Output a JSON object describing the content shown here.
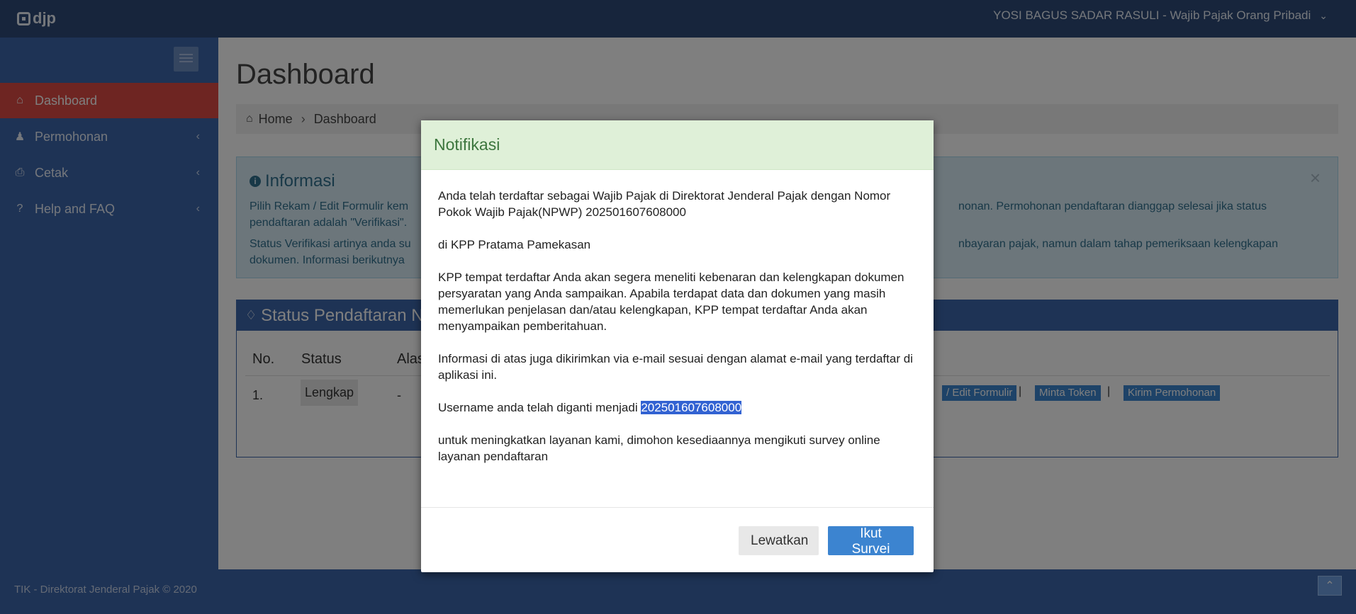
{
  "topbar": {
    "logo_text": "djp",
    "user_label": "YOSI BAGUS SADAR RASULI - Wajib Pajak Orang Pribadi"
  },
  "sidebar": {
    "items": [
      {
        "label": "Dashboard",
        "icon": "home-icon"
      },
      {
        "label": "Permohonan",
        "icon": "user-tie-icon"
      },
      {
        "label": "Cetak",
        "icon": "print-icon"
      },
      {
        "label": "Help and FAQ",
        "icon": "question-icon"
      }
    ]
  },
  "main": {
    "page_title": "Dashboard",
    "breadcrumb": {
      "home": "Home",
      "current": "Dashboard"
    },
    "info": {
      "title": "Informasi",
      "line1a": "Pilih Rekam / Edit Formulir kem",
      "line1b": "nonan. Permohonan pendaftaran dianggap selesai jika status",
      "line2a": "pendaftaran adalah \"Verifikasi\".",
      "line3a": "Status Verifikasi artinya anda su",
      "line3b": "nbayaran pajak, namun dalam tahap pemeriksaan kelengkapan",
      "line4a": "dokumen. Informasi berikutnya"
    },
    "status_panel": {
      "title": "Status Pendaftaran N",
      "columns": [
        "No.",
        "Status",
        "Alas"
      ],
      "row": {
        "no": "1.",
        "status": "Lengkap",
        "reason": "-"
      },
      "actions": [
        "/ Edit Formulir",
        "Minta Token",
        "Kirim Permohonan"
      ],
      "separator": "|"
    }
  },
  "footer": {
    "text": "TIK - Direktorat Jenderal Pajak © 2020"
  },
  "modal": {
    "title": "Notifikasi",
    "p1": "Anda telah terdaftar sebagai Wajib Pajak di Direktorat Jenderal Pajak dengan Nomor Pokok Wajib Pajak(NPWP) 202501607608000",
    "p2": "di KPP Pratama Pamekasan",
    "p3": "KPP tempat terdaftar Anda akan segera meneliti kebenaran dan kelengkapan dokumen persyaratan yang Anda sampaikan. Apabila terdapat data dan dokumen yang masih memerlukan penjelasan dan/atau kelengkapan, KPP tempat terdaftar Anda akan menyampaikan pemberitahuan.",
    "p4": "Informasi di atas juga dikirimkan via e-mail sesuai dengan alamat e-mail yang terdaftar di aplikasi ini.",
    "p5_prefix": "Username anda telah diganti menjadi ",
    "p5_username": "202501607608000",
    "p6": "untuk meningkatkan layanan kami, dimohon kesediaannya mengikuti survey online layanan pendaftaran",
    "skip_label": "Lewatkan",
    "survey_label": "Ikut Survei"
  },
  "colors": {
    "topbar": "#2e4a78",
    "sidebar": "#3d66aa",
    "active_item": "#dc4b44",
    "modal_header": "#dff0d8",
    "primary_button": "#3c84d0"
  }
}
